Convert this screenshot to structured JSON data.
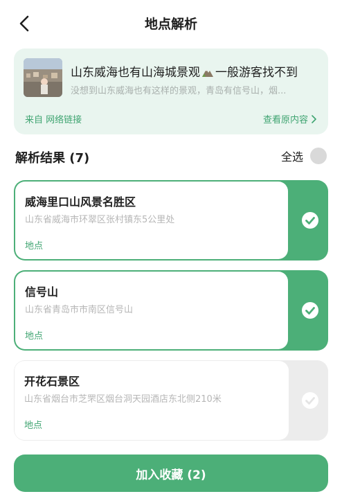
{
  "nav": {
    "title": "地点解析"
  },
  "source": {
    "title_before": "山东威海也有山海城景观",
    "title_after": "一般游客找不到",
    "description": "没想到山东威海也有这样的景观，青岛有信号山，烟...",
    "from_label": "来自 网络链接",
    "view_label": "查看原内容"
  },
  "results": {
    "heading": "解析结果 (7)",
    "select_all_label": "全选",
    "items": [
      {
        "name": "威海里口山风景名胜区",
        "address": "山东省威海市环翠区张村镇东5公里处",
        "type": "地点",
        "selected": true
      },
      {
        "name": "信号山",
        "address": "山东省青岛市市南区信号山",
        "type": "地点",
        "selected": true
      },
      {
        "name": "开花石景区",
        "address": "山东省烟台市芝罘区烟台洞天园酒店东北侧210米",
        "type": "地点",
        "selected": false
      }
    ]
  },
  "actions": {
    "add_label": "加入收藏 (2)"
  },
  "colors": {
    "accent": "#4caf78",
    "accent_text": "#3fa471",
    "card_bg": "#e9f5ef",
    "unselected": "#ececec"
  },
  "icons": [
    "back-arrow-icon",
    "mountain-emoji-icon",
    "chevron-right-icon",
    "checkmark-icon"
  ]
}
